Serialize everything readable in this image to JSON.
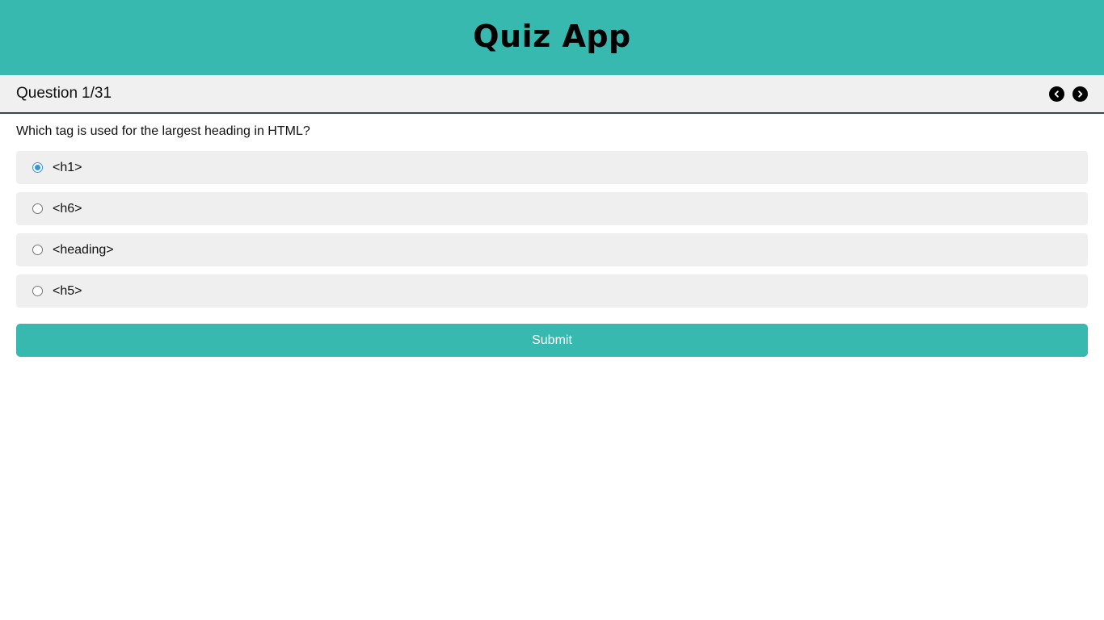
{
  "header": {
    "title": "Quiz App"
  },
  "question_bar": {
    "label": "Question",
    "current": "1",
    "separator": "/",
    "total": "31"
  },
  "nav": {
    "prev_icon": "chevron-left-icon",
    "next_icon": "chevron-right-icon"
  },
  "question": {
    "text": "Which tag is used for the largest heading in HTML?"
  },
  "options": [
    {
      "label": "<h1>",
      "selected": true
    },
    {
      "label": "<h6>",
      "selected": false
    },
    {
      "label": "<heading>",
      "selected": false
    },
    {
      "label": "<h5>",
      "selected": false
    }
  ],
  "submit": {
    "label": "Submit"
  },
  "colors": {
    "accent": "#38b9b0",
    "bar_bg": "#f0f0f0",
    "option_bg": "#efefef",
    "radio_checked": "#3397dd"
  }
}
